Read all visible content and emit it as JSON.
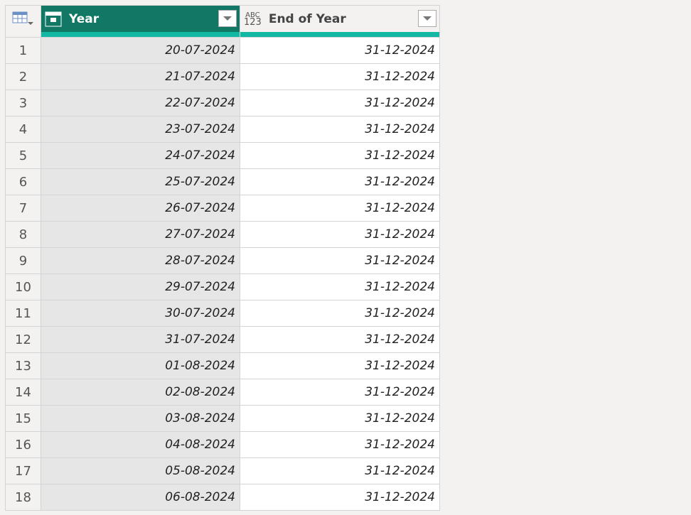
{
  "columns": [
    {
      "name": "Year",
      "type_icon": "date-icon"
    },
    {
      "name": "End of Year",
      "type_icon": "abc-123-icon"
    }
  ],
  "type_icon_text": {
    "top": "ABC",
    "bottom": "123"
  },
  "rows": [
    {
      "n": "1",
      "year": "20-07-2024",
      "eoy": "31-12-2024"
    },
    {
      "n": "2",
      "year": "21-07-2024",
      "eoy": "31-12-2024"
    },
    {
      "n": "3",
      "year": "22-07-2024",
      "eoy": "31-12-2024"
    },
    {
      "n": "4",
      "year": "23-07-2024",
      "eoy": "31-12-2024"
    },
    {
      "n": "5",
      "year": "24-07-2024",
      "eoy": "31-12-2024"
    },
    {
      "n": "6",
      "year": "25-07-2024",
      "eoy": "31-12-2024"
    },
    {
      "n": "7",
      "year": "26-07-2024",
      "eoy": "31-12-2024"
    },
    {
      "n": "8",
      "year": "27-07-2024",
      "eoy": "31-12-2024"
    },
    {
      "n": "9",
      "year": "28-07-2024",
      "eoy": "31-12-2024"
    },
    {
      "n": "10",
      "year": "29-07-2024",
      "eoy": "31-12-2024"
    },
    {
      "n": "11",
      "year": "30-07-2024",
      "eoy": "31-12-2024"
    },
    {
      "n": "12",
      "year": "31-07-2024",
      "eoy": "31-12-2024"
    },
    {
      "n": "13",
      "year": "01-08-2024",
      "eoy": "31-12-2024"
    },
    {
      "n": "14",
      "year": "02-08-2024",
      "eoy": "31-12-2024"
    },
    {
      "n": "15",
      "year": "03-08-2024",
      "eoy": "31-12-2024"
    },
    {
      "n": "16",
      "year": "04-08-2024",
      "eoy": "31-12-2024"
    },
    {
      "n": "17",
      "year": "05-08-2024",
      "eoy": "31-12-2024"
    },
    {
      "n": "18",
      "year": "06-08-2024",
      "eoy": "31-12-2024"
    }
  ],
  "colors": {
    "selected_header": "#117865",
    "quality_bar": "#12b8a3"
  }
}
